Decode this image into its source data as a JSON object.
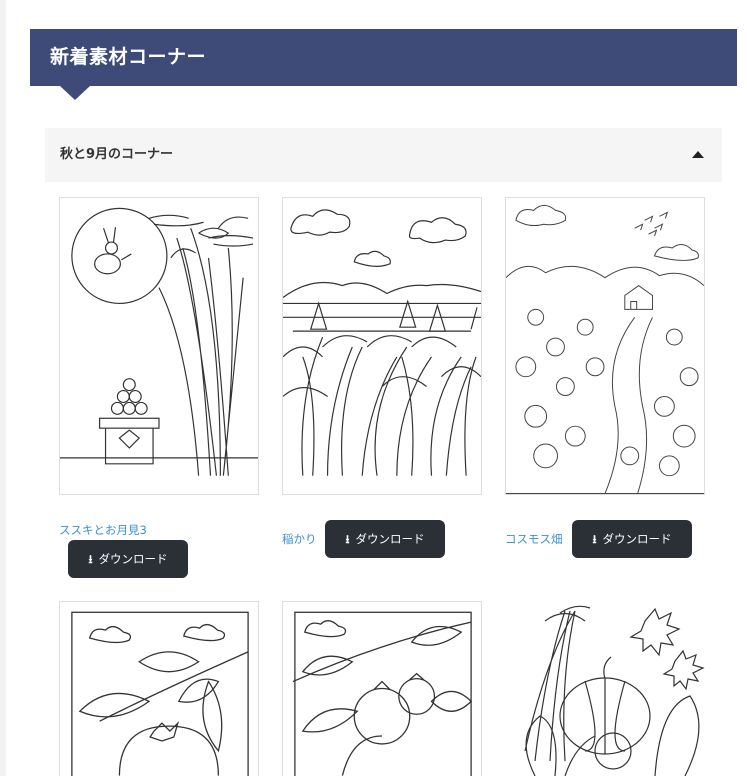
{
  "section": {
    "title": "新着素材コーナー"
  },
  "accordion": {
    "title": "秋と9月のコーナー"
  },
  "download_label": "ダウンロード",
  "icons": {
    "download": "download-icon",
    "collapse": "caret-up-icon"
  },
  "colors": {
    "header_bg": "#3e4a77",
    "button_bg": "#2b2f36",
    "link": "#3e8fd1"
  },
  "items": [
    {
      "caption": "ススキとお月見3"
    },
    {
      "caption": "稲かり"
    },
    {
      "caption": "コスモス畑"
    },
    {
      "caption": ""
    },
    {
      "caption": ""
    },
    {
      "caption": ""
    }
  ]
}
